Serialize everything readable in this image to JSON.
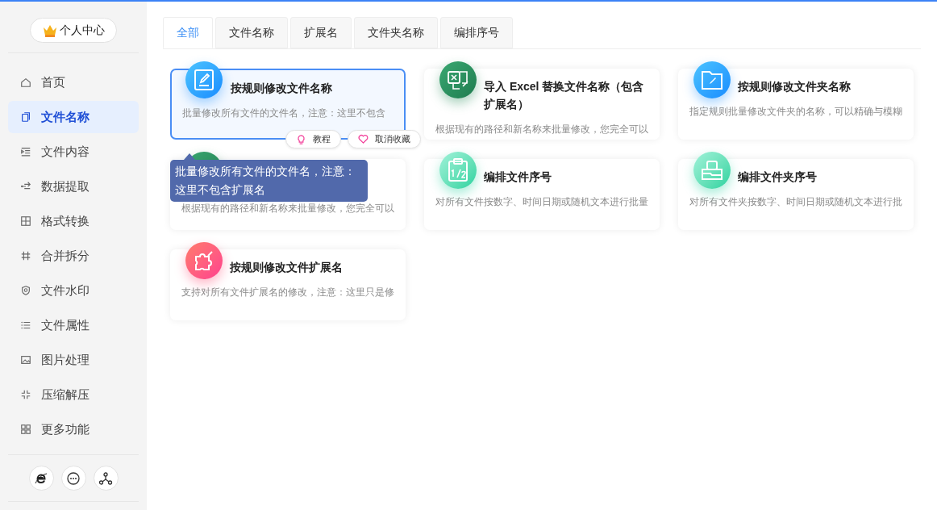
{
  "profile_button": "个人中心",
  "sidebar": {
    "items": [
      {
        "label": "首页",
        "selected": false
      },
      {
        "label": "文件名称",
        "selected": true
      },
      {
        "label": "文件内容",
        "selected": false
      },
      {
        "label": "数据提取",
        "selected": false
      },
      {
        "label": "格式转换",
        "selected": false
      },
      {
        "label": "合并拆分",
        "selected": false
      },
      {
        "label": "文件水印",
        "selected": false
      },
      {
        "label": "文件属性",
        "selected": false
      },
      {
        "label": "图片处理",
        "selected": false
      },
      {
        "label": "压缩解压",
        "selected": false
      },
      {
        "label": "更多功能",
        "selected": false
      }
    ]
  },
  "tabs": [
    {
      "label": "全部",
      "selected": true
    },
    {
      "label": "文件名称",
      "selected": false
    },
    {
      "label": "扩展名",
      "selected": false
    },
    {
      "label": "文件夹名称",
      "selected": false
    },
    {
      "label": "编排序号",
      "selected": false
    }
  ],
  "cards": [
    {
      "kind": "edit",
      "title": "按规则修改文件名称",
      "description": "批量修改所有文件的文件名，注意：这里不包含",
      "selected": true
    },
    {
      "kind": "excel",
      "title": "导入 Excel 替换文件名称（包含扩展名）",
      "description": "根据现有的路径和新名称来批量修改，您完全可以",
      "selected": false
    },
    {
      "kind": "folder",
      "title": "按规则修改文件夹名称",
      "description": "指定规则批量修改文件夹的名称，可以精确与模糊",
      "selected": false
    },
    {
      "kind": "excel",
      "description": "根据现有的路径和新名称来批量修改，您完全可以",
      "selected": false
    },
    {
      "kind": "number",
      "title": "编排文件序号",
      "description": "对所有文件按数字、时间日期或随机文本进行批量",
      "selected": false
    },
    {
      "kind": "folder-number",
      "title": "编排文件夹序号",
      "description": "对所有文件夹按数字、时间日期或随机文本进行批",
      "selected": false
    },
    {
      "kind": "extension",
      "title": "按规则修改文件扩展名",
      "description": "支持对所有文件扩展名的修改，注意：这里只是修",
      "selected": false
    }
  ],
  "card_actions": [
    {
      "kind": "tutorial",
      "label": "教程"
    },
    {
      "kind": "unfavorite",
      "label": "取消收藏"
    }
  ],
  "tooltip": "批量修改所有文件的文件名，注意：这里不包含扩展名"
}
